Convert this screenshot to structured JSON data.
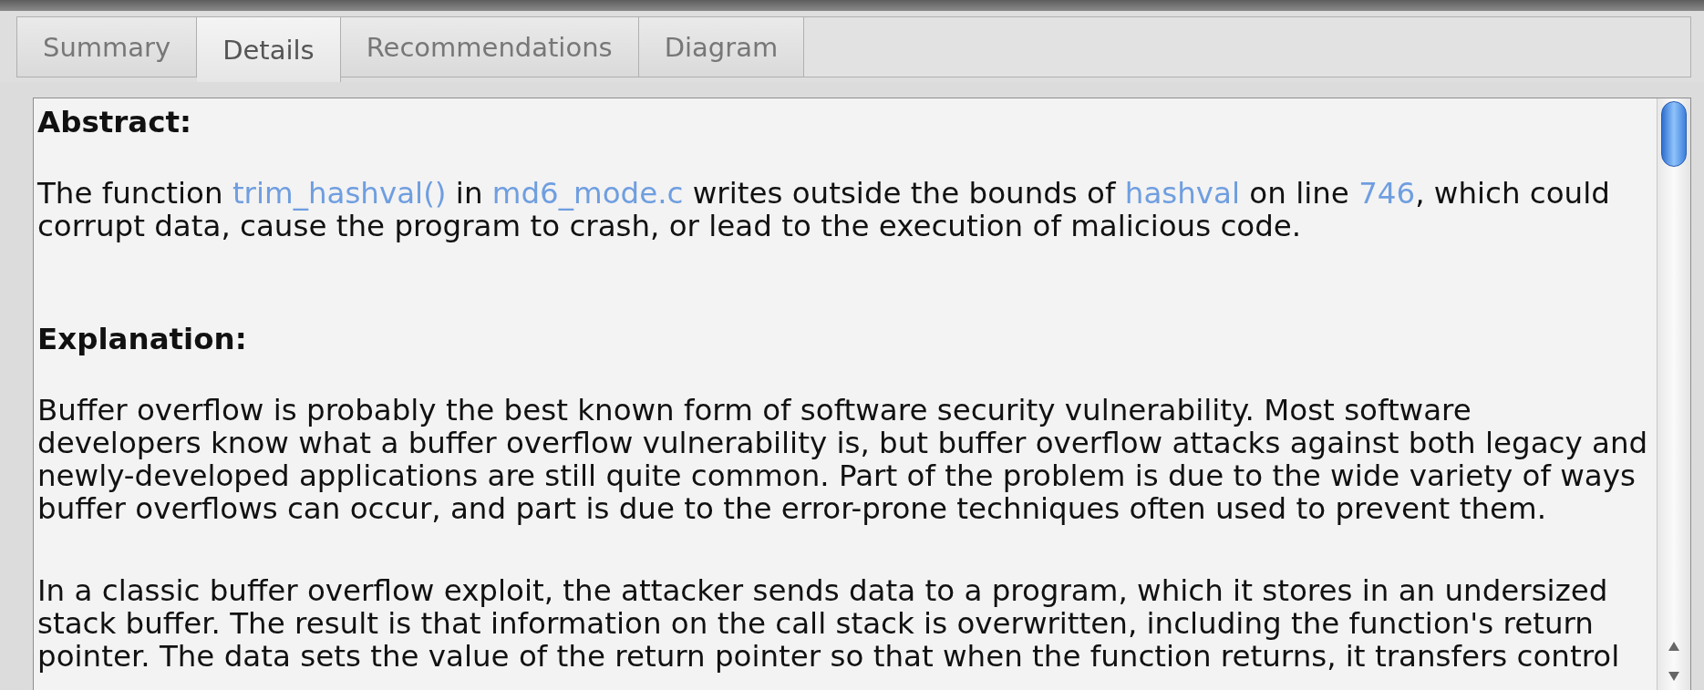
{
  "tabs": [
    {
      "label": "Summary",
      "selected": false
    },
    {
      "label": "Details",
      "selected": true
    },
    {
      "label": "Recommendations",
      "selected": false
    },
    {
      "label": "Diagram",
      "selected": false
    }
  ],
  "details": [
    {
      "kind": "heading",
      "text": "Abstract:"
    },
    {
      "kind": "paragraph",
      "lines": [
        [
          {
            "text": "The function ",
            "kind": "text"
          },
          {
            "text": "trim_hashval()",
            "kind": "link"
          },
          {
            "text": " in ",
            "kind": "text"
          },
          {
            "text": "md6_mode.c",
            "kind": "link"
          },
          {
            "text": " writes outside the bounds of ",
            "kind": "text"
          },
          {
            "text": "hashval",
            "kind": "link"
          },
          {
            "text": " on line ",
            "kind": "text"
          },
          {
            "text": "746",
            "kind": "link"
          },
          {
            "text": ", which could",
            "kind": "text"
          }
        ],
        [
          {
            "text": "corrupt data, cause the program to crash, or lead to the execution of malicious code.",
            "kind": "text"
          }
        ]
      ]
    },
    {
      "kind": "spacer"
    },
    {
      "kind": "heading",
      "text": "Explanation:"
    },
    {
      "kind": "paragraph",
      "lines": [
        [
          {
            "text": "Buffer overflow is probably the best known form of software security vulnerability. Most software",
            "kind": "text"
          }
        ],
        [
          {
            "text": "developers know what a buffer overflow vulnerability is, but buffer overflow attacks against both legacy and",
            "kind": "text"
          }
        ],
        [
          {
            "text": "newly-developed applications are still quite common. Part of the problem is due to the wide variety of ways",
            "kind": "text"
          }
        ],
        [
          {
            "text": "buffer overflows can occur, and part is due to the error-prone techniques often used to prevent them.",
            "kind": "text"
          }
        ]
      ]
    },
    {
      "kind": "paragraph",
      "lines": [
        [
          {
            "text": "In a classic buffer overflow exploit, the attacker sends data to a program, which it stores in an undersized",
            "kind": "text"
          }
        ],
        [
          {
            "text": "stack buffer. The result is that information on the call stack is overwritten, including the function's return",
            "kind": "text"
          }
        ],
        [
          {
            "text": "pointer. The data sets the value of the return pointer so that when the function returns, it transfers control",
            "kind": "text"
          }
        ]
      ]
    }
  ]
}
